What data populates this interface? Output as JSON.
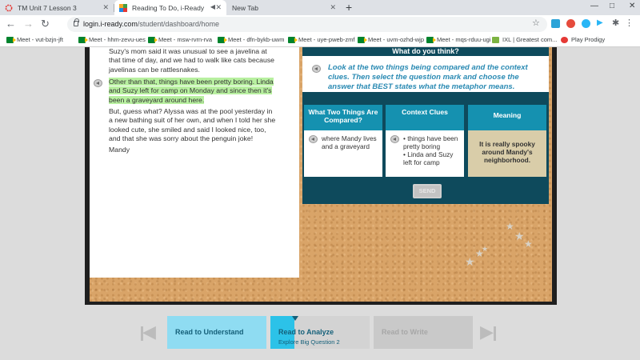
{
  "browser": {
    "tabs": [
      {
        "label": "TM Unit 7 Lesson 3"
      },
      {
        "label": "Reading To Do, i-Ready"
      },
      {
        "label": "New Tab"
      }
    ],
    "new_tab_symbol": "+",
    "close_symbol": "✕",
    "url": {
      "host": "login.i-ready.com",
      "path": "/student/dashboard/home"
    },
    "bookmarks": [
      {
        "label": "Meet - vut-bzjn-jft"
      },
      {
        "label": "Meet - hhm-zevu-ues"
      },
      {
        "label": "Meet - msw-rvrn-rva"
      },
      {
        "label": "Meet - dfn-bykb-uwm"
      },
      {
        "label": "Meet - uye-pweb-zmf"
      },
      {
        "label": "Meet - uvm-ozhd-wjp"
      },
      {
        "label": "Meet - mqs-rduu-ugi"
      },
      {
        "label": "IXL | Greatest com..."
      },
      {
        "label": "Play Prodigy"
      }
    ],
    "extension_colors": [
      "#2ba3d8",
      "#e64b3c",
      "#29b6f6",
      "#555555"
    ]
  },
  "passage": {
    "p1": "Suzy's mom said it was unusual to see a javelina at that time of day, and we had to walk like cats because javelinas can be rattlesnakes.",
    "p2": "Other than that, things have been pretty boring. Linda and Suzy left for camp on Monday and since then it's been a graveyard around here.",
    "p3": "But, guess what? Alyssa was at the pool yesterday in a new bathing suit of her own, and when I told her she looked cute, she smiled and said I looked nice, too, and that she was sorry about the penguin joke!",
    "p4": "Mandy"
  },
  "question": {
    "title": "What do you think?",
    "instruction": "Look at the two things being compared and the context clues. Then select the question mark and choose the answer that BEST states what the metaphor means.",
    "columns": [
      {
        "header": "What Two Things Are Compared?",
        "body": "where Mandy lives and a graveyard"
      },
      {
        "header": "Context Clues",
        "clue1": "• things have been pretty boring",
        "clue2": "• Linda and Suzy left for camp"
      },
      {
        "header": "Meaning",
        "body": "It is really spooky around Mandy's neighborhood."
      }
    ],
    "send_label": "SEND"
  },
  "bottom_nav": {
    "steps": [
      {
        "label": "Read to Understand"
      },
      {
        "label": "Read to Analyze",
        "sub": "Explore Big Question 2"
      },
      {
        "label": "Read to Write"
      }
    ],
    "colors": {
      "understand": "#8fdcf2",
      "analyze_fill": "#2cc2e8",
      "analyze_bg": "#d3d3d3",
      "write": "#c9c9c9",
      "accent_text": "#15607a"
    }
  }
}
